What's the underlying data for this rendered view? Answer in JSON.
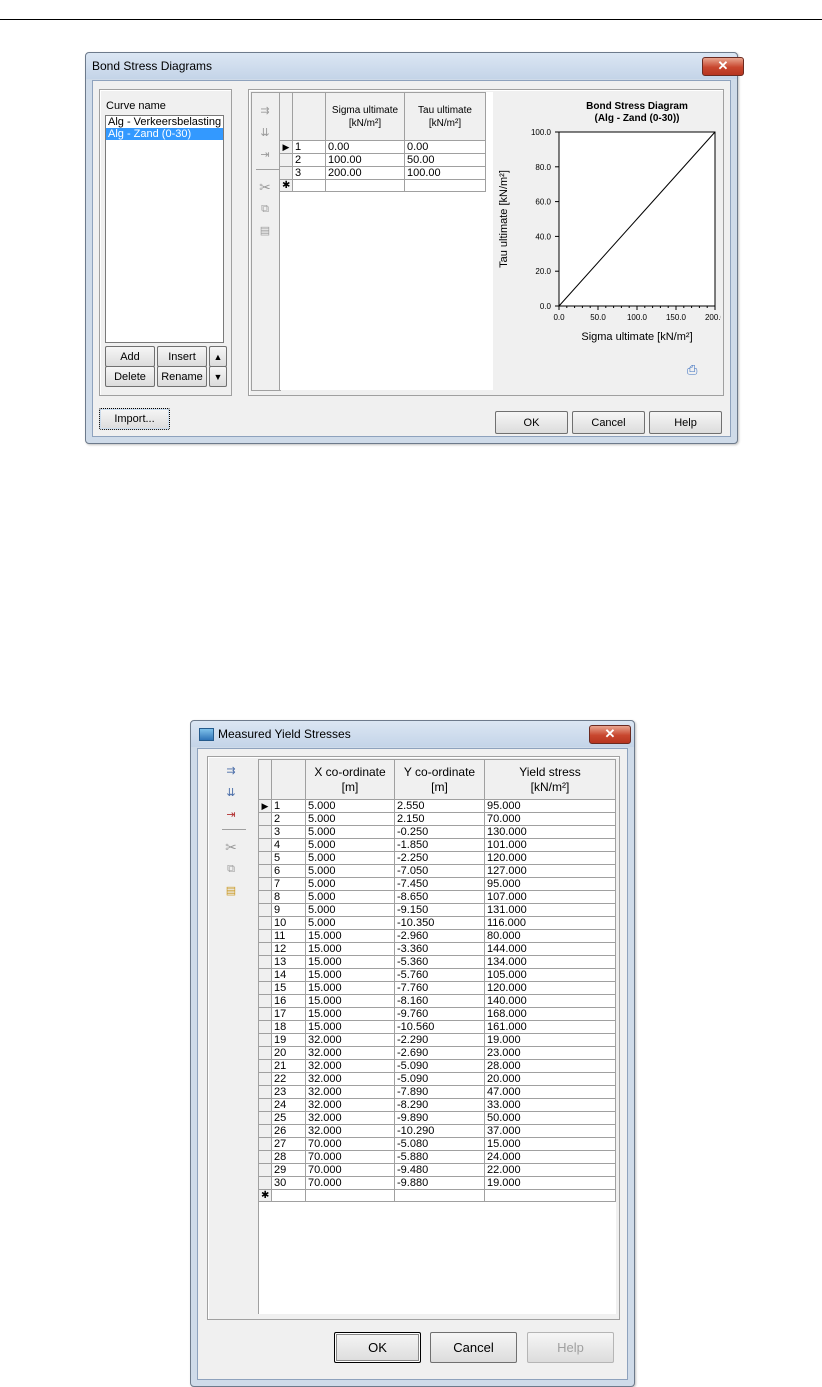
{
  "bond": {
    "title": "Bond Stress Diagrams",
    "close": "✕",
    "curve_label": "Curve name",
    "curves": [
      "Alg - Verkeersbelasting",
      "Alg - Zand (0-30)"
    ],
    "selected_curve": 1,
    "buttons": {
      "add": "Add",
      "insert": "Insert",
      "delete": "Delete",
      "rename": "Rename",
      "up": "▲",
      "down": "▼",
      "import": "Import...",
      "ok": "OK",
      "cancel": "Cancel",
      "help": "Help"
    },
    "grid": {
      "headers": [
        [
          "Sigma ultimate",
          "[kN/m²]"
        ],
        [
          "Tau ultimate",
          "[kN/m²]"
        ]
      ],
      "rows": [
        [
          "1",
          "0.00",
          "0.00"
        ],
        [
          "2",
          "100.00",
          "50.00"
        ],
        [
          "3",
          "200.00",
          "100.00"
        ]
      ],
      "new_row_marker": "✱",
      "current_row_marker": "▶"
    },
    "chart_data": {
      "type": "line",
      "title": "Bond Stress Diagram",
      "subtitle": "(Alg - Zand (0-30))",
      "xlabel": "Sigma ultimate [kN/m²]",
      "ylabel": "Tau ultimate [kN/m²]",
      "x": [
        0,
        100,
        200
      ],
      "y": [
        0,
        50,
        100
      ],
      "xlim": [
        0,
        200
      ],
      "ylim": [
        0,
        100
      ],
      "xticks": [
        "0.0",
        "50.0",
        "100.0",
        "150.0",
        "200.0"
      ],
      "yticks": [
        "0.0",
        "20.0",
        "40.0",
        "60.0",
        "80.0",
        "100.0"
      ],
      "grid": false
    },
    "print_icon": "printer-icon"
  },
  "yield": {
    "title": "Measured Yield Stresses",
    "close": "✕",
    "headers": [
      [
        "X co-ordinate",
        "[m]"
      ],
      [
        "Y co-ordinate",
        "[m]"
      ],
      [
        "Yield stress",
        "[kN/m²]"
      ]
    ],
    "rows": [
      [
        "1",
        "5.000",
        "2.550",
        "95.000"
      ],
      [
        "2",
        "5.000",
        "2.150",
        "70.000"
      ],
      [
        "3",
        "5.000",
        "-0.250",
        "130.000"
      ],
      [
        "4",
        "5.000",
        "-1.850",
        "101.000"
      ],
      [
        "5",
        "5.000",
        "-2.250",
        "120.000"
      ],
      [
        "6",
        "5.000",
        "-7.050",
        "127.000"
      ],
      [
        "7",
        "5.000",
        "-7.450",
        "95.000"
      ],
      [
        "8",
        "5.000",
        "-8.650",
        "107.000"
      ],
      [
        "9",
        "5.000",
        "-9.150",
        "131.000"
      ],
      [
        "10",
        "5.000",
        "-10.350",
        "116.000"
      ],
      [
        "11",
        "15.000",
        "-2.960",
        "80.000"
      ],
      [
        "12",
        "15.000",
        "-3.360",
        "144.000"
      ],
      [
        "13",
        "15.000",
        "-5.360",
        "134.000"
      ],
      [
        "14",
        "15.000",
        "-5.760",
        "105.000"
      ],
      [
        "15",
        "15.000",
        "-7.760",
        "120.000"
      ],
      [
        "16",
        "15.000",
        "-8.160",
        "140.000"
      ],
      [
        "17",
        "15.000",
        "-9.760",
        "168.000"
      ],
      [
        "18",
        "15.000",
        "-10.560",
        "161.000"
      ],
      [
        "19",
        "32.000",
        "-2.290",
        "19.000"
      ],
      [
        "20",
        "32.000",
        "-2.690",
        "23.000"
      ],
      [
        "21",
        "32.000",
        "-5.090",
        "28.000"
      ],
      [
        "22",
        "32.000",
        "-5.090",
        "20.000"
      ],
      [
        "23",
        "32.000",
        "-7.890",
        "47.000"
      ],
      [
        "24",
        "32.000",
        "-8.290",
        "33.000"
      ],
      [
        "25",
        "32.000",
        "-9.890",
        "50.000"
      ],
      [
        "26",
        "32.000",
        "-10.290",
        "37.000"
      ],
      [
        "27",
        "70.000",
        "-5.080",
        "15.000"
      ],
      [
        "28",
        "70.000",
        "-5.880",
        "24.000"
      ],
      [
        "29",
        "70.000",
        "-9.480",
        "22.000"
      ],
      [
        "30",
        "70.000",
        "-9.880",
        "19.000"
      ]
    ],
    "new_row_marker": "✱",
    "current_row_marker": "▶",
    "buttons": {
      "ok": "OK",
      "cancel": "Cancel",
      "help": "Help"
    }
  }
}
